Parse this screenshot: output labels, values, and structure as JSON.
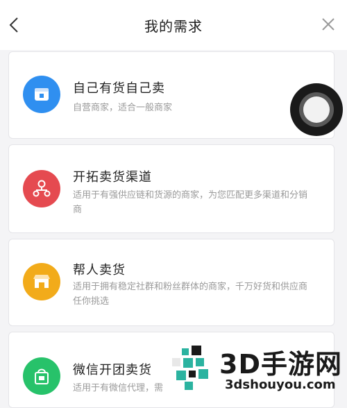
{
  "header": {
    "title": "我的需求",
    "back_icon": "chevron-left-icon",
    "close_icon": "close-icon"
  },
  "options": [
    {
      "title": "自己有货自己卖",
      "desc": "自营商家，适合一般商家",
      "icon": "store-icon",
      "color": "#2f8ff0"
    },
    {
      "title": "开拓卖货渠道",
      "desc": "适用于有强供应链和货源的商家，为您匹配更多渠道和分销商",
      "icon": "network-icon",
      "color": "#e54a50"
    },
    {
      "title": "帮人卖货",
      "desc": "适用于拥有稳定社群和粉丝群体的商家，千万好货和供应商任你挑选",
      "icon": "shop-icon",
      "color": "#f2ab1a"
    },
    {
      "title": "微信开团卖货",
      "desc": "适用于有微信代理，需",
      "icon": "bag-icon",
      "color": "#27c26a"
    }
  ],
  "watermark": {
    "text": "3D手游网",
    "url": "3dshouyou.com"
  }
}
